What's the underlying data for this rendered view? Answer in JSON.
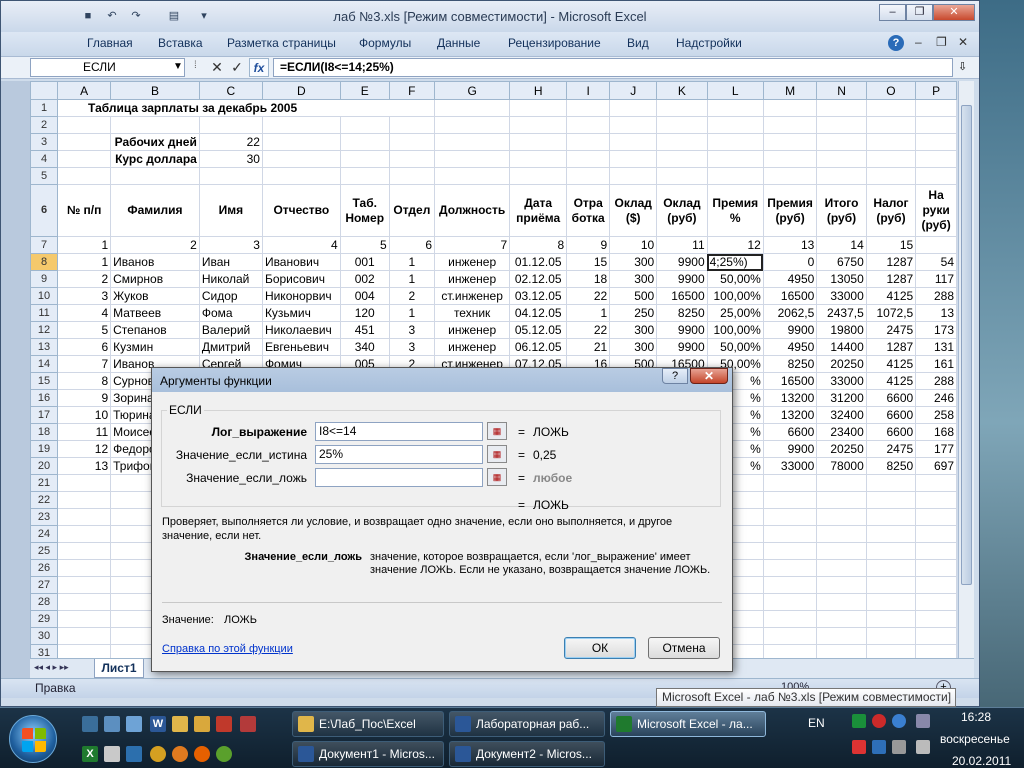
{
  "window": {
    "title": "лаб №3.xls  [Режим совместимости] - Microsoft Excel",
    "menu": [
      "Главная",
      "Вставка",
      "Разметка страницы",
      "Формулы",
      "Данные",
      "Рецензирование",
      "Вид",
      "Надстройки"
    ]
  },
  "formula_bar": {
    "name_box": "ЕСЛИ",
    "cancel_symbol": "✕",
    "enter_symbol": "✓",
    "fx_symbol": "fx",
    "formula": "=ЕСЛИ(I8<=14;25%)"
  },
  "sheet": {
    "columns": [
      "A",
      "B",
      "C",
      "D",
      "E",
      "F",
      "G",
      "H",
      "I",
      "J",
      "K",
      "L",
      "M",
      "N",
      "O",
      "P"
    ],
    "title_row": "Таблица зарплаты за декабрь 2005",
    "work_days_label": "Рабочих дней",
    "work_days": "22",
    "rate_label": "Курс доллара",
    "rate": "30",
    "headers": [
      "№ п/п",
      "Фамилия",
      "Имя",
      "Отчество",
      "Таб. Номер",
      "Отдел",
      "Должность",
      "Дата приёма",
      "Отра ботка",
      "Оклад ($)",
      "Оклад (руб)",
      "Премия %",
      "Премия (руб)",
      "Итого (руб)",
      "Налог (руб)",
      "На руки (руб)"
    ],
    "col_numbers": [
      "1",
      "2",
      "3",
      "4",
      "5",
      "6",
      "7",
      "8",
      "9",
      "10",
      "11",
      "12",
      "13",
      "14",
      "15",
      ""
    ],
    "rows": [
      [
        "1",
        "Иванов",
        "Иван",
        "Иванович",
        "001",
        "1",
        "инженер",
        "01.12.05",
        "15",
        "300",
        "9900",
        "4;25%)",
        "0",
        "6750",
        "1287",
        "54"
      ],
      [
        "2",
        "Смирнов",
        "Николай",
        "Борисович",
        "002",
        "1",
        "инженер",
        "02.12.05",
        "18",
        "300",
        "9900",
        "50,00%",
        "4950",
        "13050",
        "1287",
        "117"
      ],
      [
        "3",
        "Жуков",
        "Сидор",
        "Никонорвич",
        "004",
        "2",
        "ст.инженер",
        "03.12.05",
        "22",
        "500",
        "16500",
        "100,00%",
        "16500",
        "33000",
        "4125",
        "288"
      ],
      [
        "4",
        "Матвеев",
        "Фома",
        "Кузьмич",
        "120",
        "1",
        "техник",
        "04.12.05",
        "1",
        "250",
        "8250",
        "25,00%",
        "2062,5",
        "2437,5",
        "1072,5",
        "13"
      ],
      [
        "5",
        "Степанов",
        "Валерий",
        "Николаевич",
        "451",
        "3",
        "инженер",
        "05.12.05",
        "22",
        "300",
        "9900",
        "100,00%",
        "9900",
        "19800",
        "2475",
        "173"
      ],
      [
        "6",
        "Кузмин",
        "Дмитрий",
        "Евгеньевич",
        "340",
        "3",
        "инженер",
        "06.12.05",
        "21",
        "300",
        "9900",
        "50,00%",
        "4950",
        "14400",
        "1287",
        "131"
      ],
      [
        "7",
        "Иванов",
        "Сергей",
        "Фомич",
        "005",
        "2",
        "ст.инженер",
        "07.12.05",
        "16",
        "500",
        "16500",
        "50,00%",
        "8250",
        "20250",
        "4125",
        "161"
      ],
      [
        "8",
        "Сурнова",
        "",
        "",
        "",
        "",
        "",
        "",
        "",
        "",
        "",
        "%",
        "16500",
        "33000",
        "4125",
        "288"
      ],
      [
        "9",
        "Зорина",
        "",
        "",
        "",
        "",
        "",
        "",
        "",
        "",
        "",
        "%",
        "13200",
        "31200",
        "6600",
        "246"
      ],
      [
        "10",
        "Тюрина",
        "",
        "",
        "",
        "",
        "",
        "",
        "",
        "",
        "",
        "%",
        "13200",
        "32400",
        "6600",
        "258"
      ],
      [
        "11",
        "Моисеева",
        "",
        "",
        "",
        "",
        "",
        "",
        "",
        "",
        "",
        "%",
        "6600",
        "23400",
        "6600",
        "168"
      ],
      [
        "12",
        "Федоров",
        "",
        "",
        "",
        "",
        "",
        "",
        "",
        "",
        "",
        "%",
        "9900",
        "20250",
        "2475",
        "177"
      ],
      [
        "13",
        "Трифонов",
        "",
        "",
        "",
        "",
        "",
        "",
        "",
        "",
        "",
        "%",
        "33000",
        "78000",
        "8250",
        "697"
      ]
    ],
    "sheet_tab": "Лист1",
    "status": "Правка",
    "zoom": "100%"
  },
  "dialog": {
    "title": "Аргументы функции",
    "help_symbol": "?",
    "close_symbol": "✕",
    "function_name": "ЕСЛИ",
    "args": [
      {
        "label": "Лог_выражение",
        "value": "I8<=14",
        "result": "ЛОЖЬ"
      },
      {
        "label": "Значение_если_истина",
        "value": "25%",
        "result": "0,25"
      },
      {
        "label": "Значение_если_ложь",
        "value": "",
        "result": "любое"
      }
    ],
    "eq": "=",
    "total_result": "ЛОЖЬ",
    "description": "Проверяет, выполняется ли условие, и возвращает одно значение, если оно выполняется, и другое значение, если нет.",
    "arg_help_name": "Значение_если_ложь",
    "arg_help_text": "значение, которое возвращается, если 'лог_выражение' имеет значение ЛОЖЬ. Если не указано, возвращается значение ЛОЖЬ.",
    "value_label": "Значение:",
    "value": "ЛОЖЬ",
    "help_link": "Справка по этой функции",
    "ok": "ОК",
    "cancel": "Отмена"
  },
  "tooltip": "Microsoft Excel - лаб №3.xls  [Режим совместимости]",
  "taskbar": {
    "buttons_top": [
      "E:\\Лаб_Пос\\Excel",
      "Лабораторная раб...",
      "Microsoft Excel - ла..."
    ],
    "buttons_bottom": [
      "Документ1 - Micros...",
      "Документ2 - Micros..."
    ],
    "lang": "EN",
    "time": "16:28",
    "day": "воскресенье",
    "date": "20.02.2011"
  },
  "colors": {
    "selected_header": "#f5c96c",
    "excel_green": "#1f7a2e",
    "accent": "#12305a"
  }
}
